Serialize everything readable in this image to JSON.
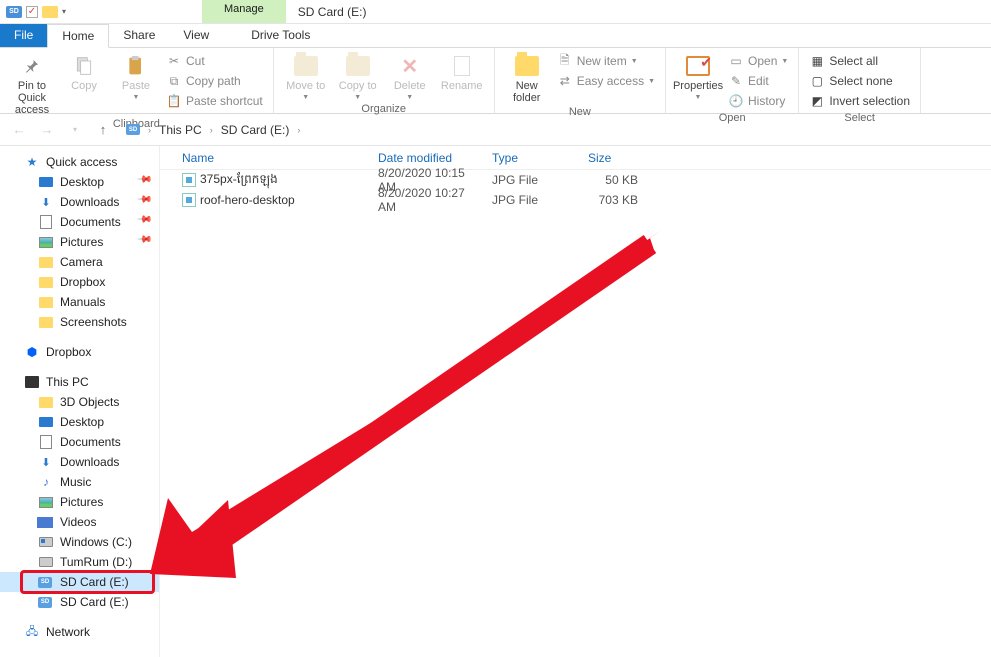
{
  "window": {
    "title": "SD Card (E:)",
    "contextual_tab": "Manage",
    "contextual_group": "Drive Tools"
  },
  "tabs": {
    "file": "File",
    "home": "Home",
    "share": "Share",
    "view": "View",
    "drivetools": "Drive Tools"
  },
  "ribbon": {
    "clipboard": {
      "label": "Clipboard",
      "pin": "Pin to Quick access",
      "copy": "Copy",
      "paste": "Paste",
      "cut": "Cut",
      "copypath": "Copy path",
      "pastesc": "Paste shortcut"
    },
    "organize": {
      "label": "Organize",
      "moveto": "Move to",
      "copyto": "Copy to",
      "delete": "Delete",
      "rename": "Rename"
    },
    "new": {
      "label": "New",
      "newfolder": "New folder",
      "newitem": "New item",
      "easyaccess": "Easy access"
    },
    "open": {
      "label": "Open",
      "properties": "Properties",
      "open": "Open",
      "edit": "Edit",
      "history": "History"
    },
    "select": {
      "label": "Select",
      "all": "Select all",
      "none": "Select none",
      "invert": "Invert selection"
    }
  },
  "breadcrumb": {
    "thispc": "This PC",
    "sdcard": "SD Card (E:)"
  },
  "columns": {
    "name": "Name",
    "date": "Date modified",
    "type": "Type",
    "size": "Size"
  },
  "files": [
    {
      "name": "375px-ព្រែកឡុង",
      "date": "8/20/2020 10:15 AM",
      "type": "JPG File",
      "size": "50 KB"
    },
    {
      "name": "roof-hero-desktop",
      "date": "8/20/2020 10:27 AM",
      "type": "JPG File",
      "size": "703 KB"
    }
  ],
  "nav": {
    "quickaccess": "Quick access",
    "qa_items": [
      {
        "label": "Desktop",
        "pinned": true,
        "icon": "monitor"
      },
      {
        "label": "Downloads",
        "pinned": true,
        "icon": "dl"
      },
      {
        "label": "Documents",
        "pinned": true,
        "icon": "doc"
      },
      {
        "label": "Pictures",
        "pinned": true,
        "icon": "pic"
      },
      {
        "label": "Camera",
        "pinned": false,
        "icon": "fold"
      },
      {
        "label": "Dropbox",
        "pinned": false,
        "icon": "fold"
      },
      {
        "label": "Manuals",
        "pinned": false,
        "icon": "fold"
      },
      {
        "label": "Screenshots",
        "pinned": false,
        "icon": "fold"
      }
    ],
    "dropbox": "Dropbox",
    "thispc": "This PC",
    "pc_items": [
      {
        "label": "3D Objects",
        "icon": "fold3d"
      },
      {
        "label": "Desktop",
        "icon": "monitor"
      },
      {
        "label": "Documents",
        "icon": "doc"
      },
      {
        "label": "Downloads",
        "icon": "dl"
      },
      {
        "label": "Music",
        "icon": "music"
      },
      {
        "label": "Pictures",
        "icon": "pic"
      },
      {
        "label": "Videos",
        "icon": "vid"
      },
      {
        "label": "Windows (C:)",
        "icon": "drivewin"
      },
      {
        "label": "TumRum (D:)",
        "icon": "drive"
      },
      {
        "label": "SD Card (E:)",
        "icon": "sd",
        "selected": true,
        "highlight": true
      },
      {
        "label": "SD Card (E:)",
        "icon": "sd"
      }
    ],
    "network": "Network"
  }
}
